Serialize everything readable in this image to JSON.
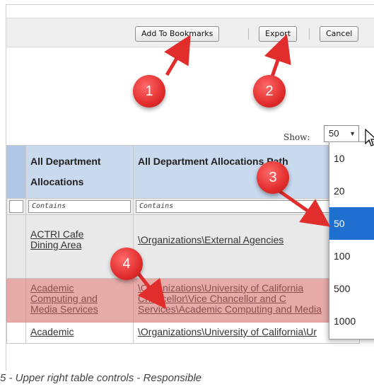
{
  "toolbar": {
    "add_bookmarks_label": "Add To Bookmarks",
    "export_label": "Export",
    "cancel_label": "Cancel"
  },
  "show": {
    "label": "Show:",
    "selected": "50",
    "options": [
      "10",
      "20",
      "50",
      "100",
      "500",
      "1000"
    ]
  },
  "table": {
    "headers": {
      "col1_line1": "All Department",
      "col1_line2": "Allocations",
      "col2": "All Department Allocations Path"
    },
    "filter_placeholder": "Contains",
    "rows": [
      {
        "name_line1": "ACTRI Cafe",
        "name_line2": "Dining Area",
        "name_line3": "",
        "path_line1": "\\Organizations\\External Agencies",
        "path_line2": "",
        "path_line3": ""
      },
      {
        "name_line1": "Academic",
        "name_line2": "Computing and",
        "name_line3": "Media Services",
        "path_line1": "\\Organizations\\University of California",
        "path_line2": "Chancellor\\Vice Chancellor and C",
        "path_line3": "Services\\Academic Computing and Media"
      },
      {
        "name_line1": "Academic",
        "name_line2": "",
        "name_line3": "",
        "path_line1": "\\Organizations\\University of California\\Ur",
        "path_line2": "",
        "path_line3": ""
      }
    ]
  },
  "badges": [
    "1",
    "2",
    "3",
    "4"
  ],
  "caption": "5 - Upper right table controls - Responsible",
  "colors": {
    "header_bg": "#c9d9ee",
    "highlight_row": "#e6aaa8",
    "badge_red": "#e22d2d",
    "selected_option": "#1f6fd0"
  }
}
